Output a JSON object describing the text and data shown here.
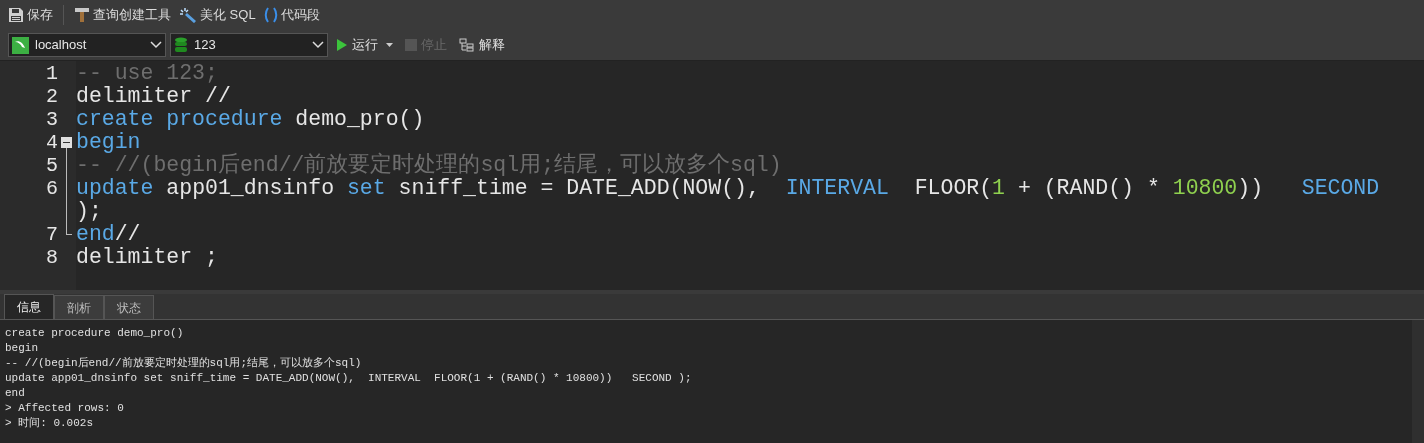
{
  "toolbar": {
    "buttons": [
      {
        "kind": "save",
        "label": "保存"
      },
      {
        "kind": "builder",
        "label": "查询创建工具"
      },
      {
        "kind": "beautify",
        "label": "美化 SQL"
      },
      {
        "kind": "snippet",
        "label": "代码段"
      }
    ]
  },
  "connection": {
    "value": "localhost"
  },
  "database": {
    "value": "123"
  },
  "actions": [
    {
      "kind": "run",
      "label": "运行",
      "disabled": false
    },
    {
      "kind": "stop",
      "label": "停止",
      "disabled": true
    },
    {
      "kind": "explain",
      "label": "解释",
      "disabled": false
    }
  ],
  "editor": {
    "lines": [
      {
        "number": "1",
        "tokens": [
          {
            "kind": "comment",
            "text": "-- use 123;"
          }
        ]
      },
      {
        "number": "2",
        "tokens": [
          {
            "kind": "plain",
            "text": "delimiter //"
          }
        ]
      },
      {
        "number": "3",
        "tokens": [
          {
            "kind": "keyword",
            "text": "create procedure"
          },
          {
            "kind": "plain",
            "text": " demo_pro()"
          }
        ]
      },
      {
        "number": "4",
        "kind": "fold_start",
        "tokens": [
          {
            "kind": "keyword",
            "text": "begin"
          }
        ]
      },
      {
        "number": "5",
        "kind": "fold_inner",
        "tokens": [
          {
            "kind": "comment",
            "text": "-- //(begin后end//前放要定时处理的sql用;结尾，可以放多个sql)"
          }
        ]
      },
      {
        "number": "6",
        "kind": "fold_inner",
        "tokens": [
          {
            "kind": "keyword",
            "text": "update"
          },
          {
            "kind": "plain",
            "text": " app01_dnsinfo "
          },
          {
            "kind": "keyword",
            "text": "set"
          },
          {
            "kind": "plain",
            "text": " sniff_time = DATE_ADD(NOW(),  "
          },
          {
            "kind": "keyword",
            "text": "INTERVAL"
          },
          {
            "kind": "plain",
            "text": "  FLOOR("
          },
          {
            "kind": "number",
            "text": "1"
          },
          {
            "kind": "plain",
            "text": " + (RAND() * "
          },
          {
            "kind": "number",
            "text": "10800"
          },
          {
            "kind": "plain",
            "text": "))   "
          },
          {
            "kind": "keyword",
            "text": "SECOND"
          }
        ],
        "continuation": [
          {
            "kind": "plain",
            "text": ");"
          }
        ]
      },
      {
        "number": "7",
        "kind": "fold_end",
        "tokens": [
          {
            "kind": "keyword",
            "text": "end"
          },
          {
            "kind": "plain",
            "text": "//"
          }
        ]
      },
      {
        "number": "8",
        "tokens": [
          {
            "kind": "plain",
            "text": "delimiter ;"
          }
        ]
      }
    ]
  },
  "result_tabs": [
    {
      "label": "信息",
      "selected": true
    },
    {
      "label": "剖析",
      "selected": false
    },
    {
      "label": "状态",
      "selected": false
    }
  ],
  "messages": [
    "create procedure demo_pro()",
    "begin",
    "-- //(begin后end//前放要定时处理的sql用;结尾，可以放多个sql)",
    "update app01_dnsinfo set sniff_time = DATE_ADD(NOW(),  INTERVAL  FLOOR(1 + (RAND() * 10800))   SECOND );",
    "end",
    "> Affected rows: 0",
    "> 时间: 0.002s"
  ]
}
